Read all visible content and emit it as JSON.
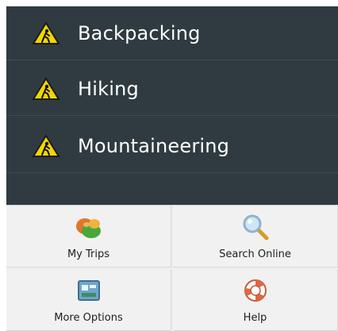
{
  "activities": {
    "items": [
      {
        "label": "Backpacking",
        "icon": "warning-hiker-icon"
      },
      {
        "label": "Hiking",
        "icon": "warning-hiker-icon"
      },
      {
        "label": "Mountaineering",
        "icon": "warning-hiker-icon"
      }
    ]
  },
  "options_menu": {
    "items": [
      {
        "label": "My Trips",
        "icon": "my-trips-icon"
      },
      {
        "label": "Search Online",
        "icon": "magnifier-icon"
      },
      {
        "label": "More Options",
        "icon": "more-options-icon"
      },
      {
        "label": "Help",
        "icon": "lifebuoy-icon"
      }
    ]
  },
  "colors": {
    "list_background": "#2f3b40",
    "menu_background": "#ededed",
    "warning_yellow": "#f2d600"
  }
}
